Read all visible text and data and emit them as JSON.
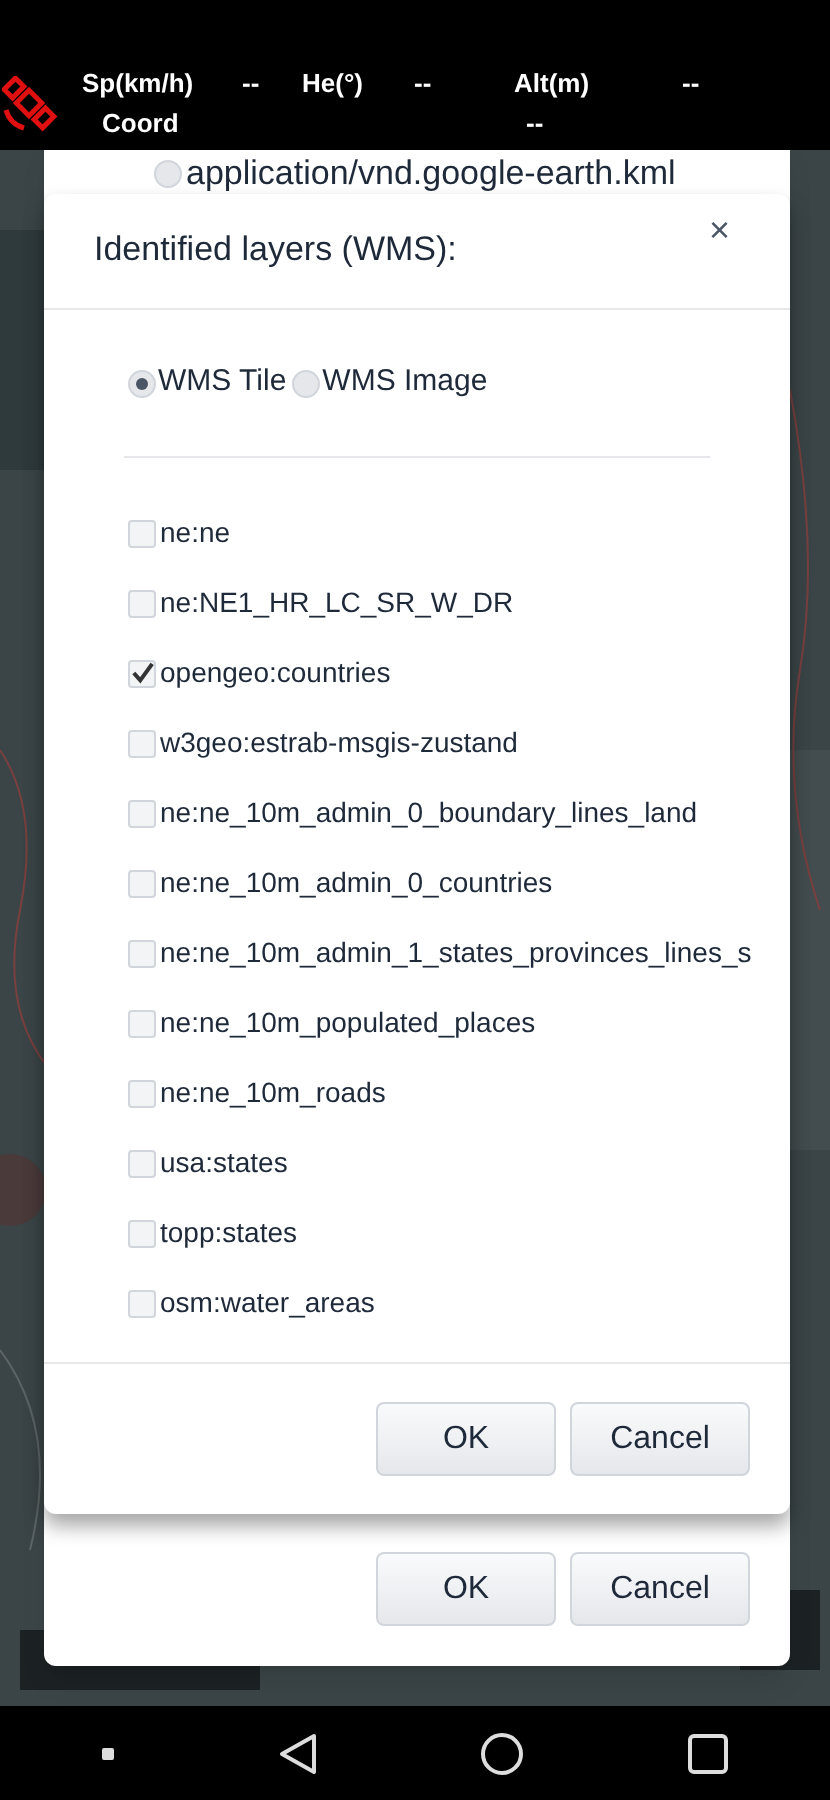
{
  "header": {
    "cells": [
      {
        "label": "Sp(km/h)",
        "value": "--"
      },
      {
        "label": "He(°)",
        "value": "--"
      },
      {
        "label": "Alt(m)",
        "value": "--"
      }
    ],
    "coord": {
      "label": "Coord",
      "value": "--"
    }
  },
  "back_dialog": {
    "option": {
      "label": "application/vnd.google-earth.kml",
      "selected": false
    },
    "buttons": [
      "OK",
      "Cancel"
    ]
  },
  "dialog": {
    "title": "Identified layers (WMS):",
    "close": "×",
    "modes": [
      {
        "label": "WMS Tile",
        "selected": true
      },
      {
        "label": "WMS Image",
        "selected": false
      }
    ],
    "layers": [
      {
        "label": "ne:ne",
        "checked": false
      },
      {
        "label": "ne:NE1_HR_LC_SR_W_DR",
        "checked": false
      },
      {
        "label": "opengeo:countries",
        "checked": true
      },
      {
        "label": "w3geo:estrab-msgis-zustand",
        "checked": false
      },
      {
        "label": "ne:ne_10m_admin_0_boundary_lines_land",
        "checked": false
      },
      {
        "label": "ne:ne_10m_admin_0_countries",
        "checked": false
      },
      {
        "label": "ne:ne_10m_admin_1_states_provinces_lines_s",
        "checked": false
      },
      {
        "label": "ne:ne_10m_populated_places",
        "checked": false
      },
      {
        "label": "ne:ne_10m_roads",
        "checked": false
      },
      {
        "label": "usa:states",
        "checked": false
      },
      {
        "label": "topp:states",
        "checked": false
      },
      {
        "label": "osm:water_areas",
        "checked": false
      }
    ],
    "buttons": [
      "OK",
      "Cancel"
    ]
  }
}
